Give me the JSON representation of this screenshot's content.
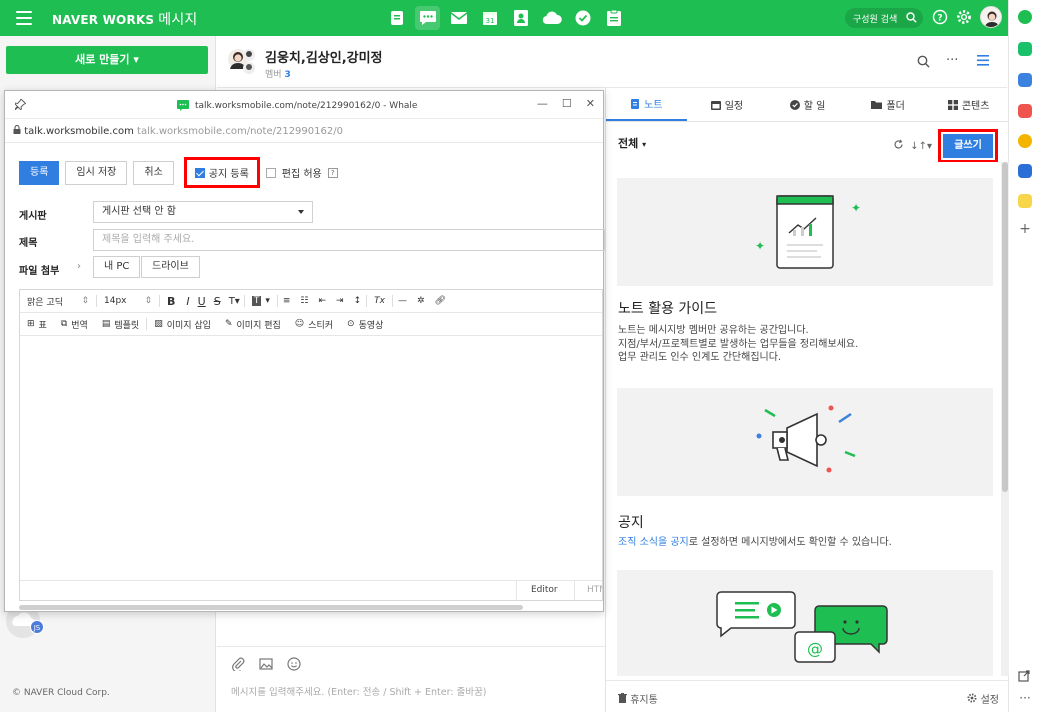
{
  "topbar": {
    "brand": "NAVER WORKS",
    "app": "메시지",
    "search_label": "구성원 검색",
    "colors": {
      "green": "#1fbe53"
    }
  },
  "left": {
    "new_button": "새로 만들기",
    "footer": "© NAVER Cloud Corp."
  },
  "chat": {
    "title": "김웅치,김상인,강미정",
    "members_label": "멤버",
    "members_count": "3",
    "input_placeholder": "메시지를 입력해주세요. (Enter: 전송 / Shift + Enter: 줄바꿈)"
  },
  "note_panel": {
    "tabs": [
      {
        "label": "노트",
        "icon": "note-icon",
        "active": true
      },
      {
        "label": "일정",
        "icon": "calendar-icon",
        "active": false
      },
      {
        "label": "할 일",
        "icon": "check-icon",
        "active": false
      },
      {
        "label": "폴더",
        "icon": "folder-icon",
        "active": false
      },
      {
        "label": "콘텐츠",
        "icon": "grid-icon",
        "active": false
      }
    ],
    "filter": "전체",
    "write_button": "글쓰기",
    "cards": [
      {
        "title": "노트 활용 가이드",
        "desc": [
          "노트는 메시지방 멤버만 공유하는 공간입니다.",
          "지점/부서/프로젝트별로 발생하는 업무들을 정리해보세요.",
          "업무 관리도 인수 인계도 간단해집니다."
        ]
      },
      {
        "title": "공지",
        "desc_link": "조직 소식을 공지",
        "desc_rest": "로 설정하면 메시지방에서도 확인할 수 있습니다."
      }
    ],
    "trash": "휴지통",
    "settings": "설정"
  },
  "popup": {
    "window_title": "talk.worksmobile.com/note/212990162/0 - Whale",
    "address_host": "talk.worksmobile.com",
    "address_full": "talk.worksmobile.com/note/212990162/0",
    "buttons": {
      "register": "등록",
      "temp_save": "임시 저장",
      "cancel": "취소",
      "notice": "공지 등록",
      "allow_edit": "편집 허용"
    },
    "form": {
      "board_label": "게시판",
      "board_value": "게시판 선택 안 함",
      "subject_label": "제목",
      "subject_placeholder": "제목을 입력해 주세요.",
      "attach_label": "파일 첨부",
      "attach_pc": "내 PC",
      "attach_drive": "드라이브"
    },
    "toolbar1": {
      "font": "맑은 고딕",
      "size": "14px"
    },
    "toolbar2": {
      "table": "표",
      "translate": "번역",
      "template": "템플릿",
      "image_insert": "이미지 삽입",
      "image_edit": "이미지 편집",
      "sticker": "스티커",
      "video": "동영상"
    },
    "editor_tabs": [
      "Editor",
      "HTML"
    ]
  },
  "footer_left": {
    "badge": "JS"
  }
}
